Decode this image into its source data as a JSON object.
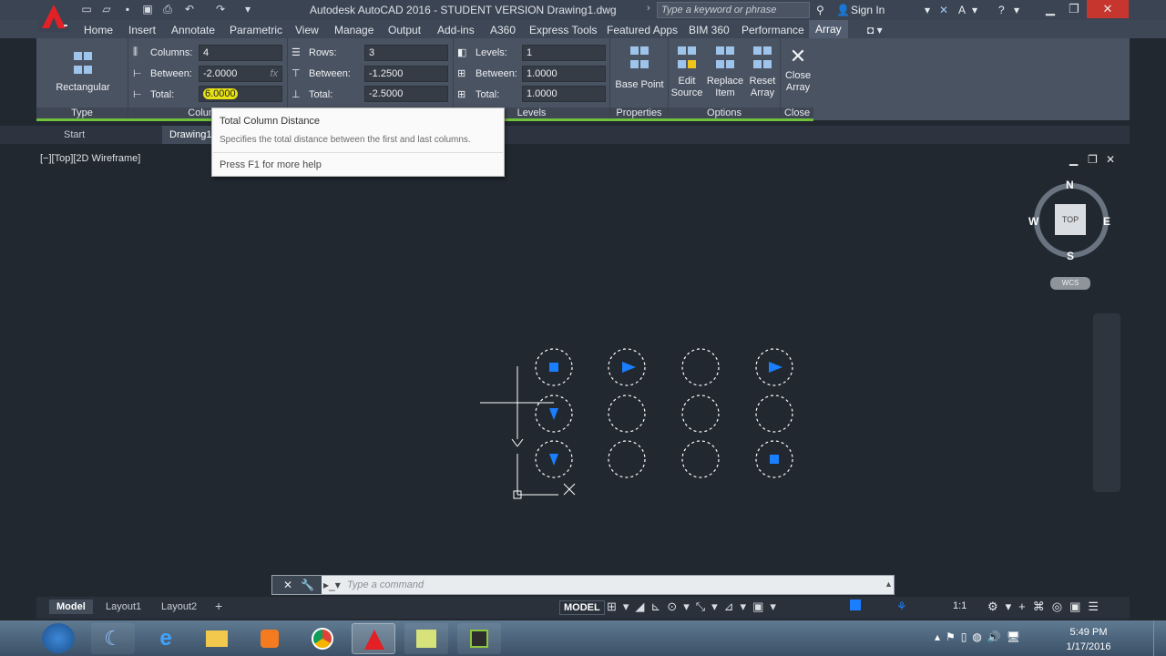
{
  "app": {
    "title": "Autodesk AutoCAD 2016 - STUDENT VERSION   Drawing1.dwg",
    "search_placeholder": "Type a keyword or phrase",
    "sign_in": "Sign In"
  },
  "ribbon_tabs": [
    "Home",
    "Insert",
    "Annotate",
    "Parametric",
    "View",
    "Manage",
    "Output",
    "Add-ins",
    "A360",
    "Express Tools",
    "Featured Apps",
    "BIM 360",
    "Performance",
    "Array"
  ],
  "ribbon": {
    "type_button": "Rectangular",
    "type_label": "Type",
    "columns": {
      "label": "Columns:",
      "value": "4",
      "between_label": "Between:",
      "between_value": "-2.0000",
      "total_label": "Total:",
      "total_value": "6.0000",
      "group_label": "Columns"
    },
    "rows": {
      "label": "Rows:",
      "value": "3",
      "between_label": "Between:",
      "between_value": "-1.2500",
      "total_label": "Total:",
      "total_value": "-2.5000"
    },
    "levels": {
      "label": "Levels:",
      "value": "1",
      "between_label": "Between:",
      "between_value": "1.0000",
      "total_label": "Total:",
      "total_value": "1.0000",
      "group_label": "Levels"
    },
    "base_point": "Base Point",
    "properties_label": "Properties",
    "edit_source": "Edit Source",
    "replace_item": "Replace Item",
    "reset_array": "Reset Array",
    "options_label": "Options",
    "close_array": "Close Array",
    "close_label": "Close"
  },
  "tooltip": {
    "title": "Total Column Distance",
    "body": "Specifies the total distance between the first and last columns.",
    "help": "Press F1 for more help"
  },
  "doc_tabs": {
    "start": "Start",
    "drawing": "Drawing1"
  },
  "viewport": {
    "label": "[−][Top][2D Wireframe]"
  },
  "viewcube": {
    "n": "N",
    "s": "S",
    "e": "E",
    "w": "W",
    "top": "TOP",
    "wcs": "WCS"
  },
  "command": {
    "placeholder": "Type  a  command"
  },
  "layout_tabs": [
    "Model",
    "Layout1",
    "Layout2"
  ],
  "status": {
    "model": "MODEL",
    "scale": "1:1"
  },
  "taskbar": {
    "time": "5:49 PM",
    "date": "1/17/2016"
  },
  "colors": {
    "accent": "#6fc03b",
    "glyph": "#1a7fff",
    "titlebar": "#3b4453",
    "ribbon": "#4a5362"
  }
}
